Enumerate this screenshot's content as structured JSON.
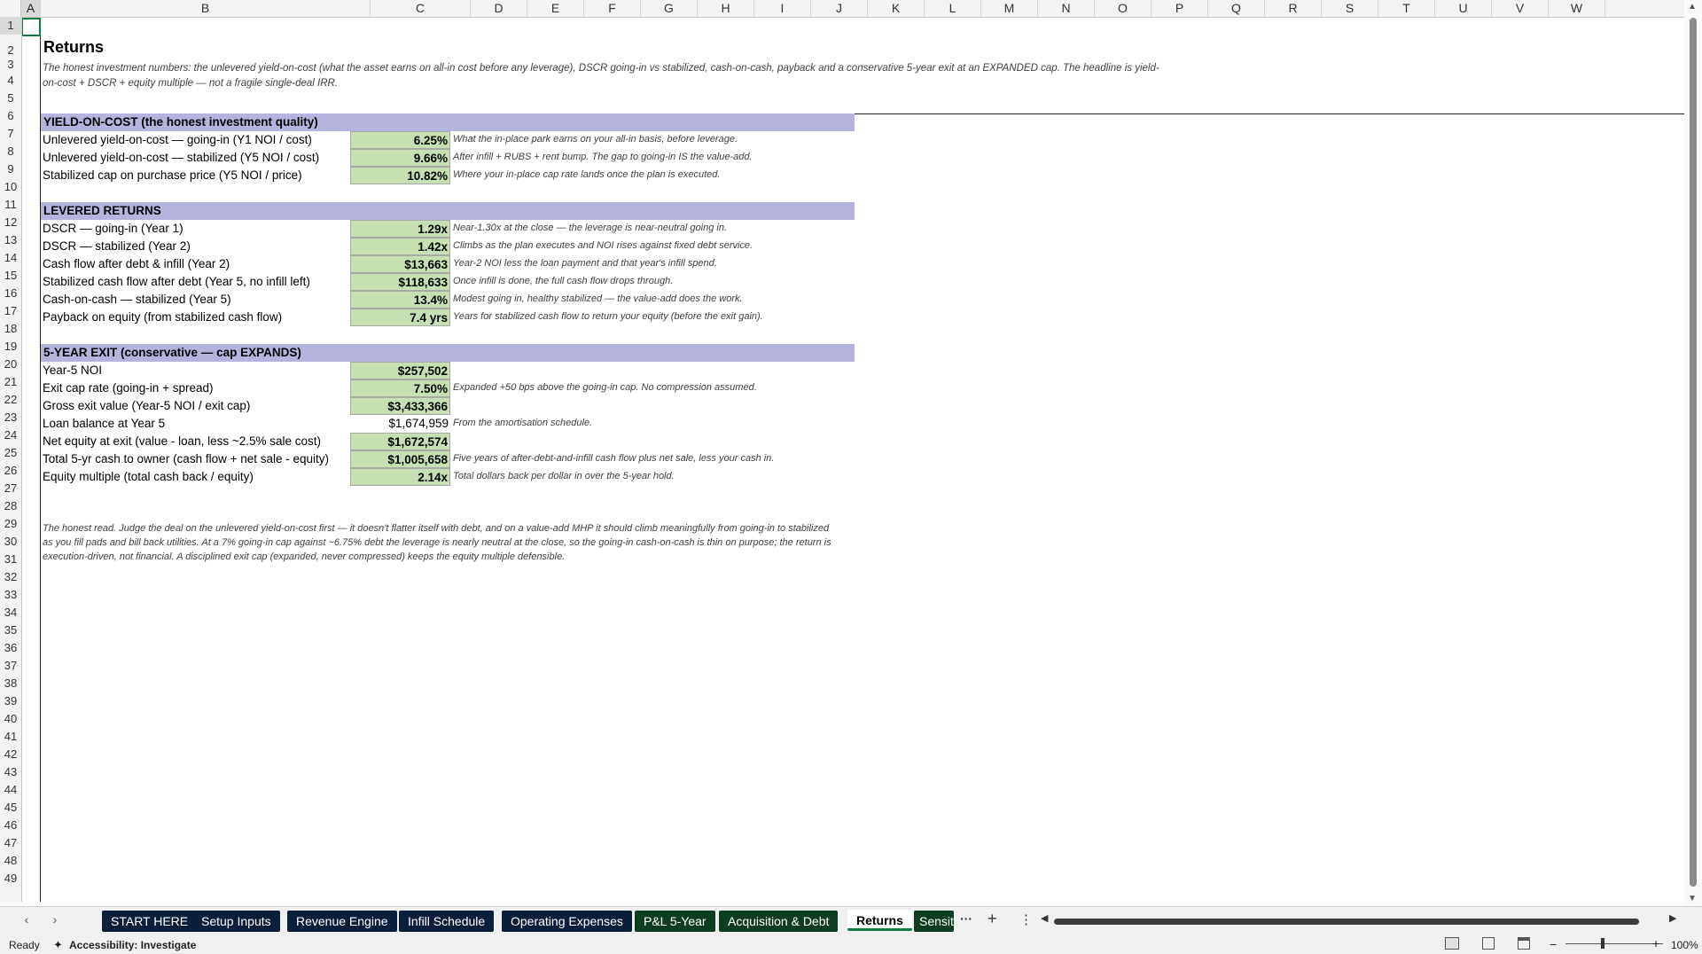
{
  "columns": [
    "A",
    "B",
    "C",
    "D",
    "E",
    "F",
    "G",
    "H",
    "I",
    "J",
    "K",
    "L",
    "M",
    "N",
    "O",
    "P",
    "Q",
    "R",
    "S",
    "T",
    "U",
    "V",
    "W"
  ],
  "rows": [
    "1",
    "2",
    "3",
    "4",
    "5",
    "6",
    "7",
    "8",
    "9",
    "10",
    "11",
    "12",
    "13",
    "14",
    "15",
    "16",
    "17",
    "18",
    "19",
    "20",
    "21",
    "22",
    "23",
    "24",
    "25",
    "26",
    "27",
    "28",
    "29",
    "30",
    "31",
    "32",
    "33",
    "34",
    "35",
    "36",
    "37",
    "38",
    "39",
    "40",
    "41",
    "42",
    "43",
    "44",
    "45",
    "46",
    "47",
    "48",
    "49"
  ],
  "sheet": {
    "title": "Returns",
    "subtitle_line1": "The honest investment numbers: the unlevered yield-on-cost (what the asset earns on all-in cost before any leverage), DSCR going-in vs stabilized, cash-on-cash, payback and a conservative 5-year exit at an EXPANDED cap. The headline is yield-",
    "subtitle_line2": "on-cost + DSCR + equity multiple — not a fragile single-deal IRR.",
    "section_yield": "YIELD-ON-COST (the honest investment quality)",
    "section_levered": "LEVERED RETURNS",
    "section_exit": "5-YEAR EXIT (conservative — cap EXPANDS)",
    "yield_rows": [
      {
        "label": "Unlevered yield-on-cost — going-in (Y1 NOI / cost)",
        "value": "6.25%",
        "note": "What the in-place park earns on your all-in basis, before leverage."
      },
      {
        "label": "Unlevered yield-on-cost — stabilized (Y5 NOI / cost)",
        "value": "9.66%",
        "note": "After infill + RUBS + rent bump. The gap to going-in IS the value-add."
      },
      {
        "label": "Stabilized cap on purchase price (Y5 NOI / price)",
        "value": "10.82%",
        "note": "Where your in-place cap rate lands once the plan is executed."
      }
    ],
    "levered_rows": [
      {
        "label": "DSCR — going-in (Year 1)",
        "value": "1.29x",
        "note": "Near-1.30x at the close — the leverage is near-neutral going in."
      },
      {
        "label": "DSCR — stabilized (Year 2)",
        "value": "1.42x",
        "note": "Climbs as the plan executes and NOI rises against fixed debt service."
      },
      {
        "label": "Cash flow after debt & infill (Year 2)",
        "value": "$13,663",
        "note": "Year-2 NOI less the loan payment and that year's infill spend."
      },
      {
        "label": "Stabilized cash flow after debt (Year 5, no infill left)",
        "value": "$118,633",
        "note": "Once infill is done, the full cash flow drops through."
      },
      {
        "label": "Cash-on-cash — stabilized (Year 5)",
        "value": "13.4%",
        "note": "Modest going in, healthy stabilized — the value-add does the work."
      },
      {
        "label": "Payback on equity (from stabilized cash flow)",
        "value": "7.4 yrs",
        "note": "Years for stabilized cash flow to return your equity (before the exit gain)."
      }
    ],
    "exit_rows": [
      {
        "label": "Year-5 NOI",
        "value": "$257,502",
        "note": "",
        "boxed": true
      },
      {
        "label": "Exit cap rate (going-in + spread)",
        "value": "7.50%",
        "note": "Expanded +50 bps above the going-in cap. No compression assumed.",
        "boxed": true
      },
      {
        "label": "Gross exit value (Year-5 NOI / exit cap)",
        "value": "$3,433,366",
        "note": "",
        "boxed": true
      },
      {
        "label": "Loan balance at Year 5",
        "value": "$1,674,959",
        "note": "From the amortisation schedule.",
        "boxed": false
      },
      {
        "label": "Net equity at exit (value - loan, less ~2.5% sale cost)",
        "value": "$1,672,574",
        "note": "",
        "boxed": true
      },
      {
        "label": "Total 5-yr cash to owner (cash flow + net sale - equity)",
        "value": "$1,005,658",
        "note": "Five years of after-debt-and-infill cash flow plus net sale, less your cash in.",
        "boxed": true
      },
      {
        "label": "Equity multiple (total cash back / equity)",
        "value": "2.14x",
        "note": "Total dollars back per dollar in over the 5-year hold.",
        "boxed": true
      }
    ],
    "closing_line1": "The honest read. Judge the deal on the unlevered yield-on-cost first — it doesn't flatter itself with debt, and on a value-add MHP it should climb meaningfully from going-in to stabilized",
    "closing_line2": "as you fill pads and bill back utilities. At a 7% going-in cap against ~6.75% debt the leverage is nearly neutral at the close, so the going-in cash-on-cash is thin on purpose; the return is",
    "closing_line3": "execution-driven, not financial. A disciplined exit cap (expanded, never compressed) keeps the equity multiple defensible."
  },
  "tabs": [
    {
      "label": "START HERE",
      "style": "navy"
    },
    {
      "label": "Setup Inputs",
      "style": "navy"
    },
    {
      "label": "Revenue Engine",
      "style": "navy"
    },
    {
      "label": "Infill Schedule",
      "style": "navy"
    },
    {
      "label": "Operating Expenses",
      "style": "navy"
    },
    {
      "label": "P&L 5-Year",
      "style": "green"
    },
    {
      "label": "Acquisition & Debt",
      "style": "green"
    },
    {
      "label": "Returns",
      "style": "active"
    },
    {
      "label": "Sensit",
      "style": "green"
    }
  ],
  "tabbar": {
    "more": "···",
    "add": "+",
    "menu": "⋮"
  },
  "status": {
    "ready": "Ready",
    "accessibility": "Accessibility: Investigate",
    "zoom": "100%"
  }
}
